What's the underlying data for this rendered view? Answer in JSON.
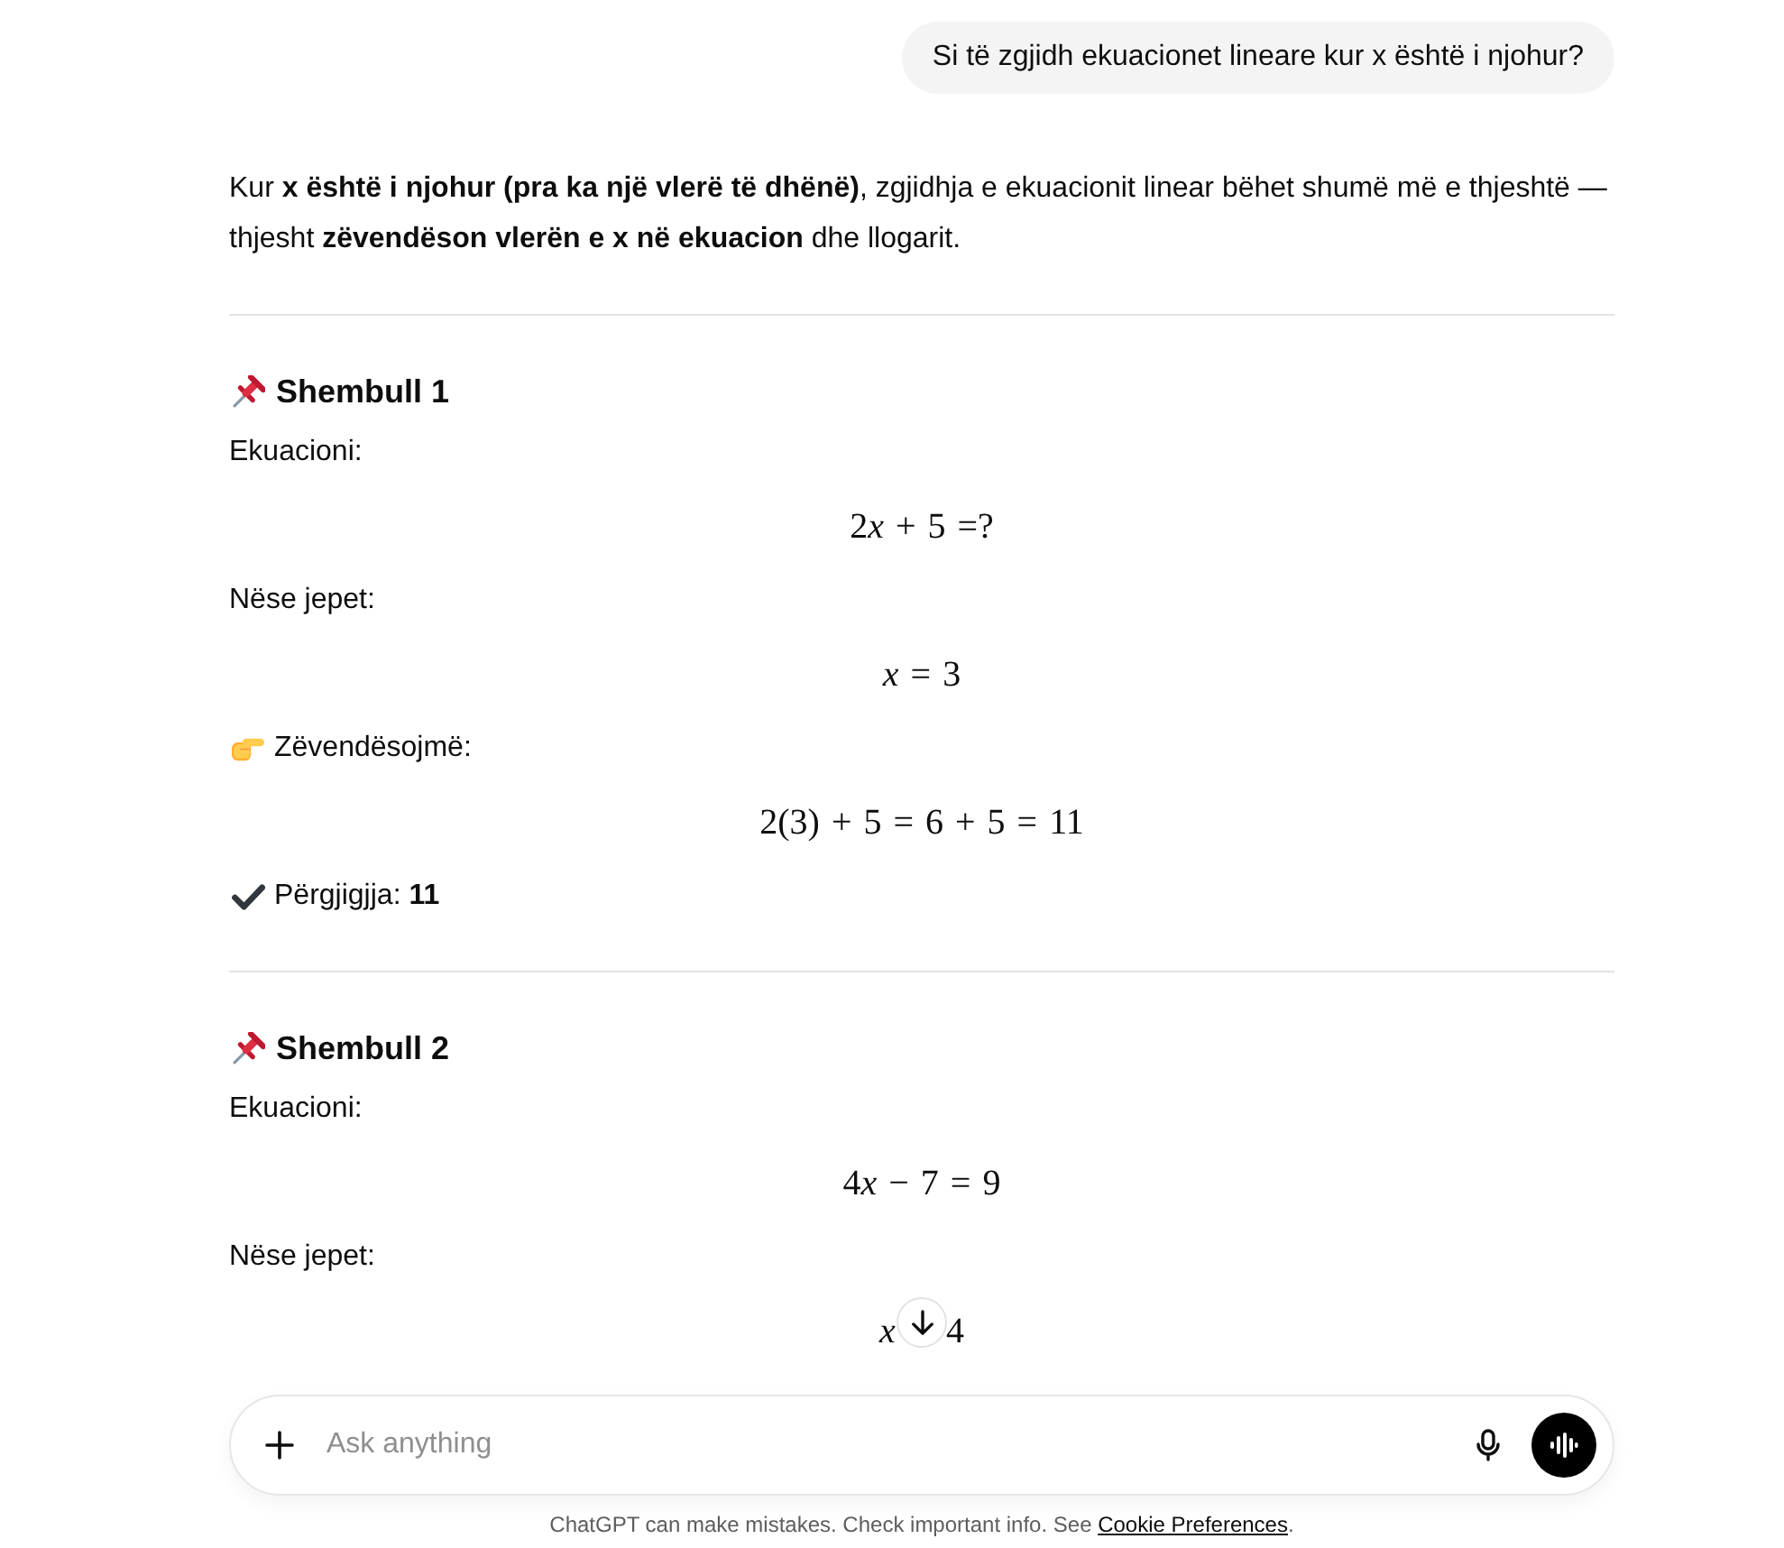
{
  "user_message": {
    "text": "Si të zgjidh ekuacionet lineare kur x është i njohur?"
  },
  "response": {
    "intro": "Kur **x është i njohur (pra ka një vlerë të dhënë)**, zgjidhja e ekuacionit linear bëhet shumë më e thjeshtë — thjesht **zëvendëson vlerën e x në ekuacion** dhe llogarit.",
    "sections": [
      {
        "heading": "Shembull 1",
        "lines": [
          {
            "kind": "label",
            "text": "Ekuacioni:"
          },
          {
            "kind": "math",
            "text": "2x + 5 =?"
          },
          {
            "kind": "label",
            "text": "Nëse jepet:"
          },
          {
            "kind": "math",
            "text": "x = 3"
          },
          {
            "kind": "step",
            "text": "Zëvendësojmë:"
          },
          {
            "kind": "math",
            "text": "2(3) + 5 = 6 + 5 = 11"
          },
          {
            "kind": "answer",
            "text": "Përgjigjja: **11**"
          }
        ]
      },
      {
        "heading": "Shembull 2",
        "lines": [
          {
            "kind": "label",
            "text": "Ekuacioni:"
          },
          {
            "kind": "math",
            "text": "4x − 7 = 9"
          },
          {
            "kind": "label",
            "text": "Nëse jepet:"
          },
          {
            "kind": "math_covered",
            "parts": [
              "x",
              "4"
            ]
          }
        ]
      }
    ]
  },
  "composer": {
    "placeholder": "Ask anything"
  },
  "footer": {
    "text": "ChatGPT can make mistakes. Check important info. See ",
    "link": "Cookie Preferences",
    "end": "."
  }
}
